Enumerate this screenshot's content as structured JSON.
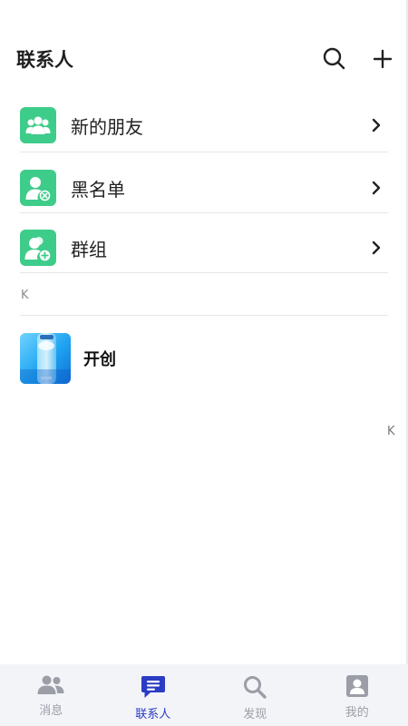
{
  "header": {
    "title": "联系人"
  },
  "menu": [
    {
      "label": "新的朋友",
      "icon": "new-friends-icon"
    },
    {
      "label": "黑名单",
      "icon": "blacklist-icon"
    },
    {
      "label": "群组",
      "icon": "group-icon"
    }
  ],
  "section": {
    "letter": "K"
  },
  "contacts": [
    {
      "name": "开创"
    }
  ],
  "index": {
    "letter": "K"
  },
  "tabbar": [
    {
      "label": "消息",
      "icon": "users-icon",
      "active": false
    },
    {
      "label": "联系人",
      "icon": "chat-bubble-icon",
      "active": true
    },
    {
      "label": "发现",
      "icon": "search-icon",
      "active": false
    },
    {
      "label": "我的",
      "icon": "profile-icon",
      "active": false
    }
  ],
  "colors": {
    "accent": "#2a3cc4",
    "menu_icon_bg": "#3ecc8a",
    "inactive": "#9b9ea6",
    "tabbar_bg": "#f3f4f8"
  }
}
